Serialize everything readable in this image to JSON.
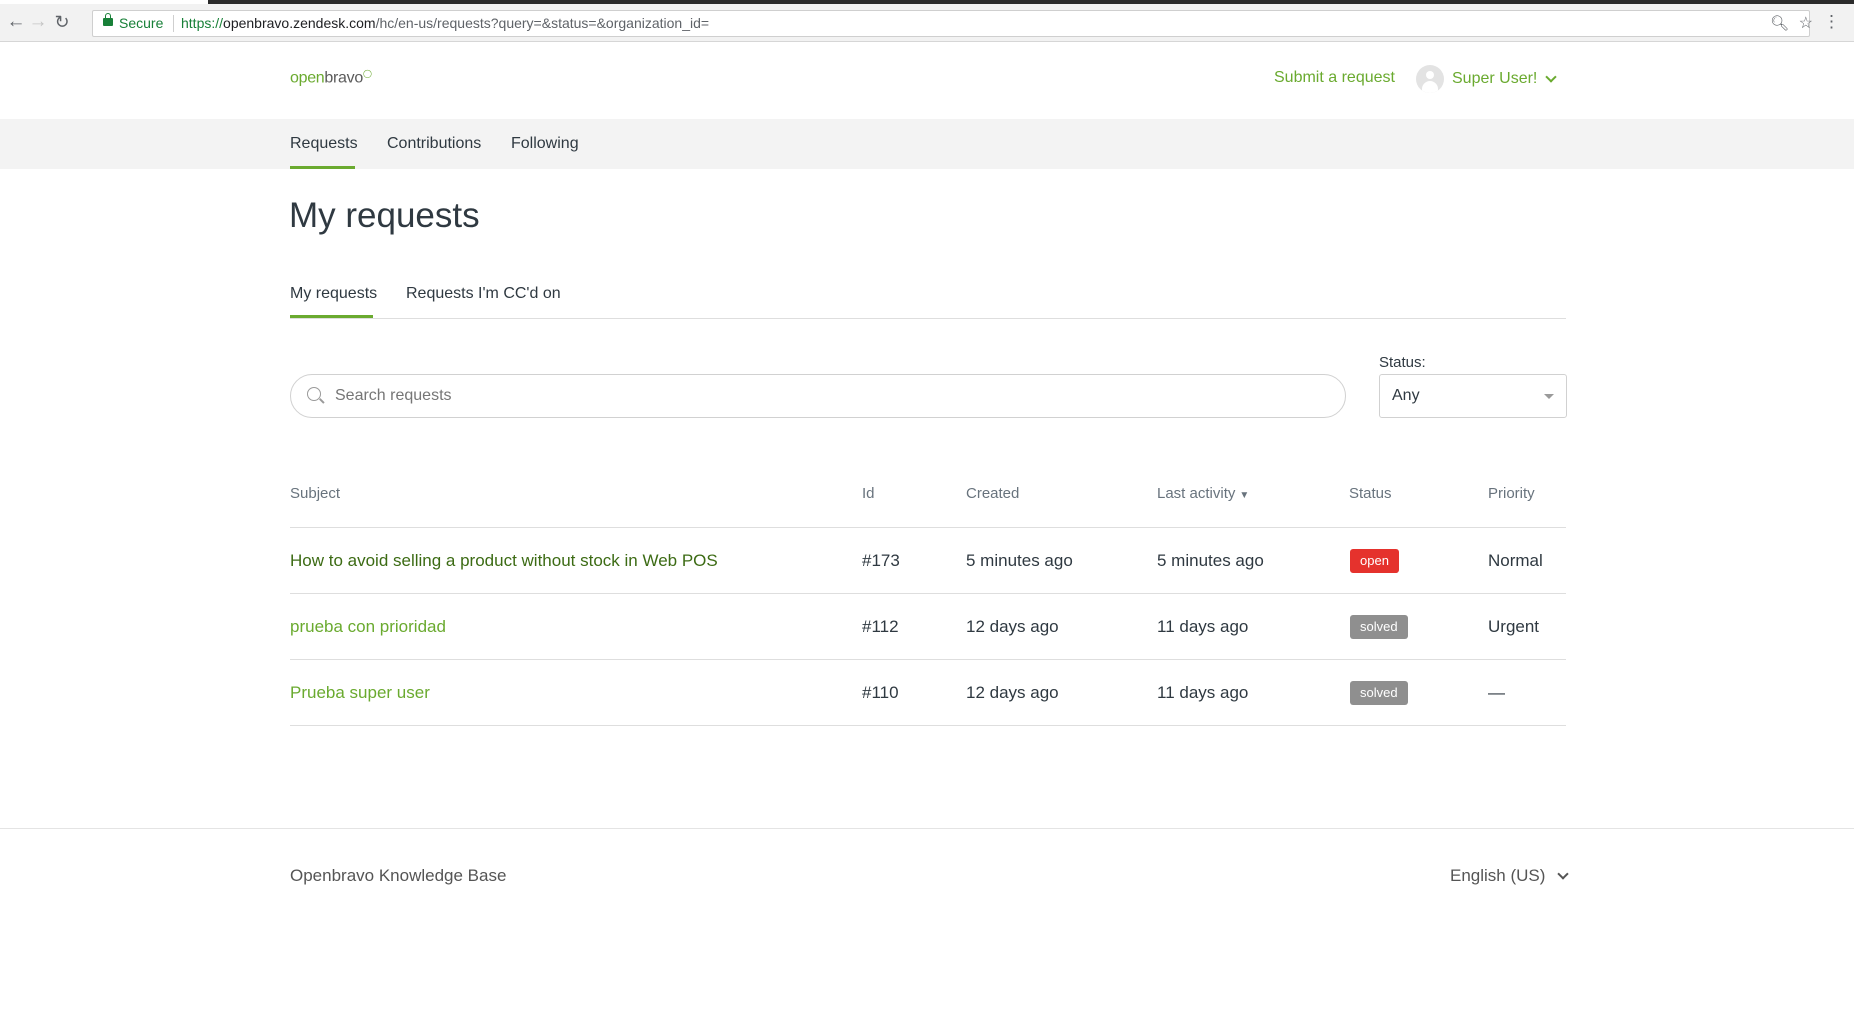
{
  "browser": {
    "secure_label": "Secure",
    "url_protocol": "https://",
    "url_host": "openbravo.zendesk.com",
    "url_path": "/hc/en-us/requests?query=&status=&organization_id="
  },
  "header": {
    "logo_green": "open",
    "logo_dark": "bravo",
    "submit_label": "Submit a request",
    "user_name": "Super User!"
  },
  "subnav": {
    "items": [
      {
        "label": "Requests"
      },
      {
        "label": "Contributions"
      },
      {
        "label": "Following"
      }
    ]
  },
  "main": {
    "title": "My requests",
    "tabs": [
      {
        "label": "My requests"
      },
      {
        "label": "Requests I'm CC'd on"
      }
    ],
    "search_placeholder": "Search requests",
    "status_label": "Status:",
    "status_value": "Any"
  },
  "table": {
    "headers": {
      "subject": "Subject",
      "id": "Id",
      "created": "Created",
      "last_activity": "Last activity",
      "sort_arrow": "▼",
      "status": "Status",
      "priority": "Priority"
    },
    "rows": [
      {
        "subject": "How to avoid selling a product without stock in Web POS",
        "id": "#173",
        "created": "5 minutes ago",
        "last_activity": "5 minutes ago",
        "status": "open",
        "priority": "Normal"
      },
      {
        "subject": "prueba con prioridad",
        "id": "#112",
        "created": "12 days ago",
        "last_activity": "11 days ago",
        "status": "solved",
        "priority": "Urgent"
      },
      {
        "subject": "Prueba super user",
        "id": "#110",
        "created": "12 days ago",
        "last_activity": "11 days ago",
        "status": "solved",
        "priority": "—"
      }
    ]
  },
  "footer": {
    "title": "Openbravo Knowledge Base",
    "language": "English (US)"
  },
  "colors": {
    "brand_green": "#6aaa2f",
    "open_badge": "#e5322d",
    "solved_badge": "#8f8f8f"
  }
}
